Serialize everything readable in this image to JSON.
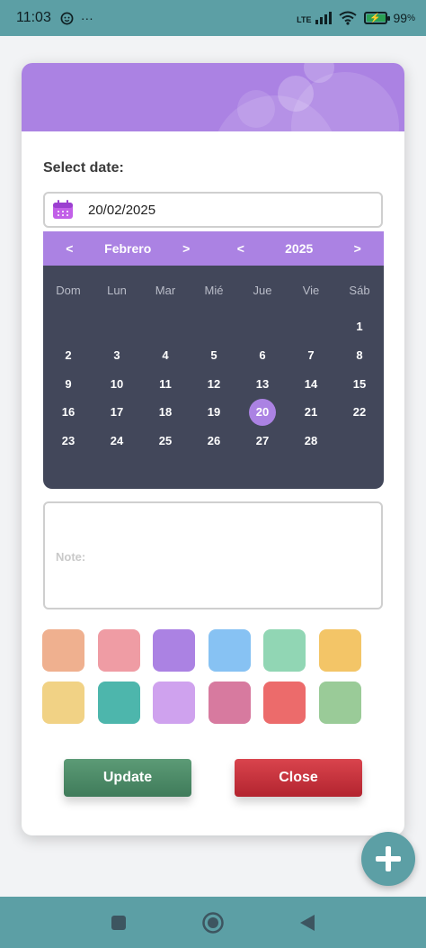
{
  "status_bar": {
    "time": "11:03",
    "more": "···",
    "network": "LTE",
    "battery_percent": "99",
    "battery_unit": "%"
  },
  "form": {
    "select_date_label": "Select date:",
    "date_value": "20/02/2025",
    "note_label": "Note:"
  },
  "calendar": {
    "month": "Febrero",
    "year": "2025",
    "prev": "<",
    "next": ">",
    "weekdays": [
      "Dom",
      "Lun",
      "Mar",
      "Mié",
      "Jue",
      "Vie",
      "Sáb"
    ],
    "days": [
      "",
      "",
      "",
      "",
      "",
      "",
      "1",
      "2",
      "3",
      "4",
      "5",
      "6",
      "7",
      "8",
      "9",
      "10",
      "11",
      "12",
      "13",
      "14",
      "15",
      "16",
      "17",
      "18",
      "19",
      "20",
      "21",
      "22",
      "23",
      "24",
      "25",
      "26",
      "27",
      "28",
      ""
    ],
    "selected_day": "20"
  },
  "colors": {
    "accent": "#ab82e3",
    "teal": "#5c9fa5",
    "swatches": [
      "#efb08f",
      "#ef9ca4",
      "#ab82e3",
      "#87c2f3",
      "#91d6b4",
      "#f3c567",
      "#f1d285",
      "#4db6ac",
      "#cfa2ee",
      "#d77a9f",
      "#ec6b6b",
      "#9acb98"
    ]
  },
  "buttons": {
    "update": "Update",
    "close": "Close"
  }
}
